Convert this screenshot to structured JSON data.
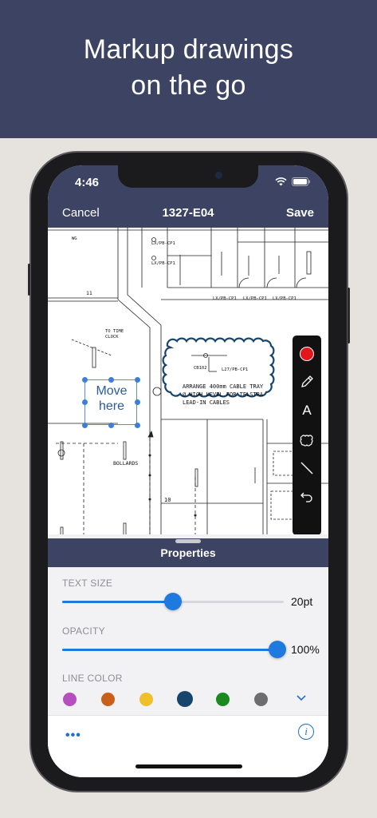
{
  "hero": {
    "title": "Markup drawings\non the go"
  },
  "status": {
    "time": "4:46"
  },
  "nav": {
    "cancel": "Cancel",
    "title": "1327-E04",
    "save": "Save"
  },
  "drawing": {
    "annotation_text": "Move\nhere",
    "cloud_note": "ARRANGE 400mm CABLE TRAY\n@ HIGH LEVEL FOR TELSTRA\nLEAD-IN CABLES",
    "labels": {
      "wg": "WG",
      "lx1": "LX/PB-CP1",
      "lx2": "LX/PB-CP1",
      "lx3": "LX/PB-CP1",
      "lx4": "LX/PB-CP1",
      "lx5": "LX/PB-CP1",
      "to_time_clock": "TO TIME\nCLOCK",
      "cb102": "CB102",
      "l27": "L27/PB-CP1",
      "bollards": "BOLLARDS",
      "n11": "11",
      "n10": "10"
    }
  },
  "toolbar": {
    "tools": [
      {
        "name": "color-tool",
        "icon": "red-dot-icon"
      },
      {
        "name": "pen-tool",
        "icon": "pencil-icon"
      },
      {
        "name": "text-tool",
        "icon": "text-icon",
        "label": "A"
      },
      {
        "name": "cloud-tool",
        "icon": "cloud-shape-icon"
      },
      {
        "name": "line-tool",
        "icon": "line-icon"
      },
      {
        "name": "undo-tool",
        "icon": "undo-icon"
      }
    ],
    "active_color": "#e3161b"
  },
  "properties": {
    "title": "Properties",
    "text_size": {
      "label": "TEXT SIZE",
      "value": "20pt",
      "fraction": 0.5
    },
    "opacity": {
      "label": "OPACITY",
      "value": "100%",
      "fraction": 1.0
    },
    "line_color": {
      "label": "LINE COLOR",
      "swatches": [
        "#b44fbd",
        "#c8601a",
        "#f0c02a",
        "#17456d",
        "#1a8a1f",
        "#6e6e6e"
      ],
      "selected_index": 3
    }
  },
  "bottom": {
    "more_label": "•••",
    "info_label": "i"
  },
  "colors": {
    "brand": "#3d4463",
    "accent": "#1f7ae0"
  }
}
